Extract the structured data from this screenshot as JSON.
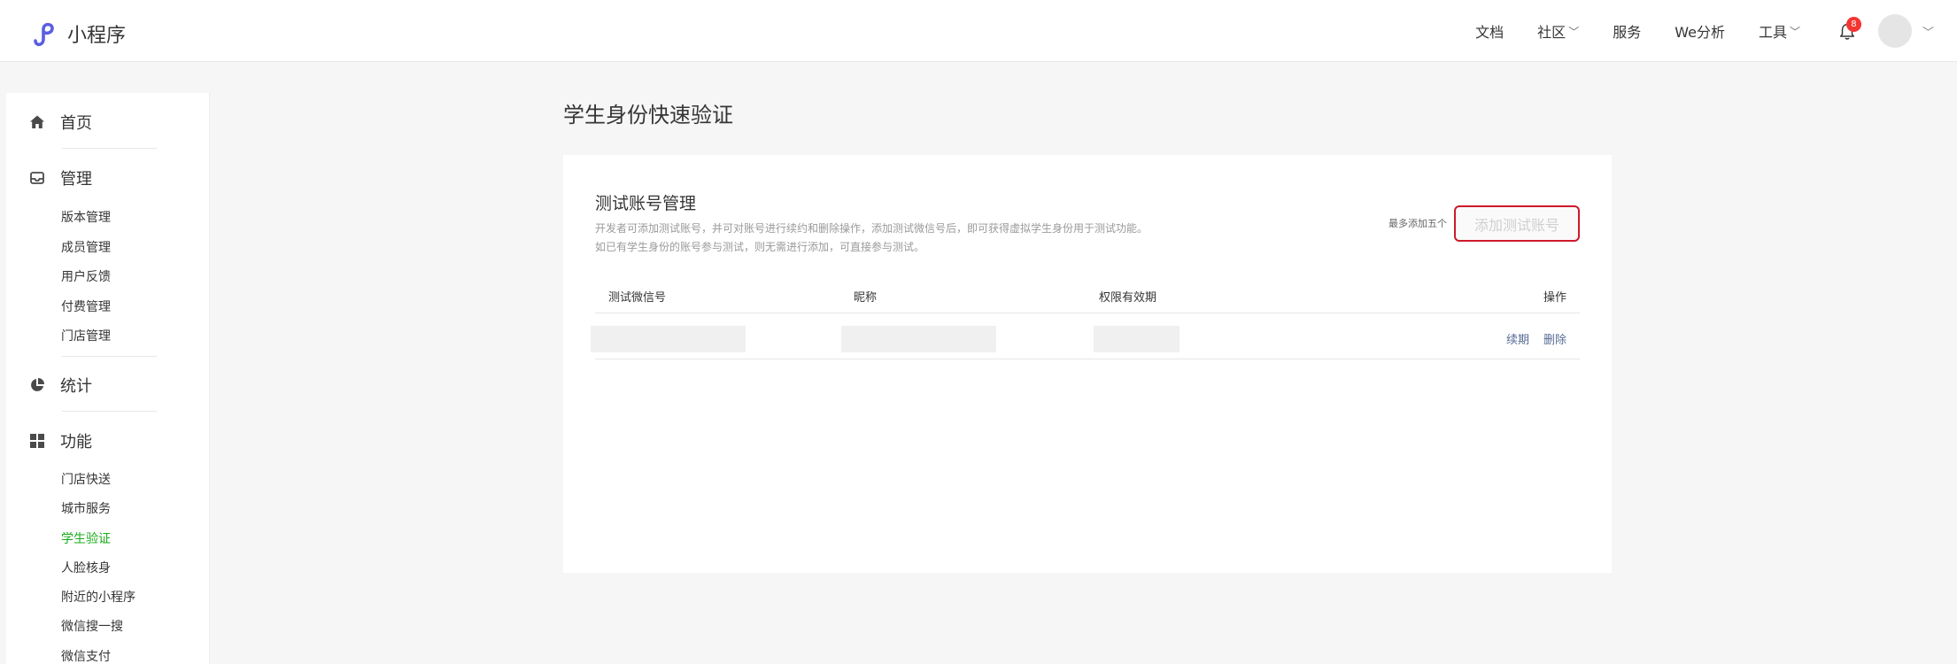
{
  "header": {
    "app_name": "小程序",
    "nav": [
      {
        "label": "文档",
        "dropdown": false
      },
      {
        "label": "社区",
        "dropdown": true
      },
      {
        "label": "服务",
        "dropdown": false
      },
      {
        "label": "We分析",
        "dropdown": false
      },
      {
        "label": "工具",
        "dropdown": true
      }
    ],
    "notification_count": "8"
  },
  "sidebar": {
    "home": "首页",
    "manage": {
      "label": "管理",
      "items": [
        "版本管理",
        "成员管理",
        "用户反馈",
        "付费管理",
        "门店管理"
      ]
    },
    "stats": "统计",
    "features": {
      "label": "功能",
      "items": [
        "门店快送",
        "城市服务",
        "学生验证",
        "人脸核身",
        "附近的小程序",
        "微信搜一搜",
        "微信支付"
      ],
      "active": "学生验证"
    }
  },
  "main": {
    "page_title": "学生身份快速验证",
    "card": {
      "title": "测试账号管理",
      "desc_line1": "开发者可添加测试账号，并可对账号进行续约和删除操作，添加测试微信号后，即可获得虚拟学生身份用于测试功能。",
      "desc_line2": "如已有学生身份的账号参与测试，则无需进行添加，可直接参与测试。",
      "limit_text": "最多添加五个",
      "add_button": "添加测试账号",
      "table": {
        "headers": [
          "测试微信号",
          "昵称",
          "权限有效期",
          "操作"
        ],
        "rows": [
          {
            "actions": [
              "续期",
              "删除"
            ]
          }
        ]
      }
    }
  },
  "colors": {
    "brand": "#5b5fe0",
    "active_menu": "#1aad19",
    "link": "#576b95",
    "badge": "#f43530",
    "button_border": "#cc1a2a"
  }
}
